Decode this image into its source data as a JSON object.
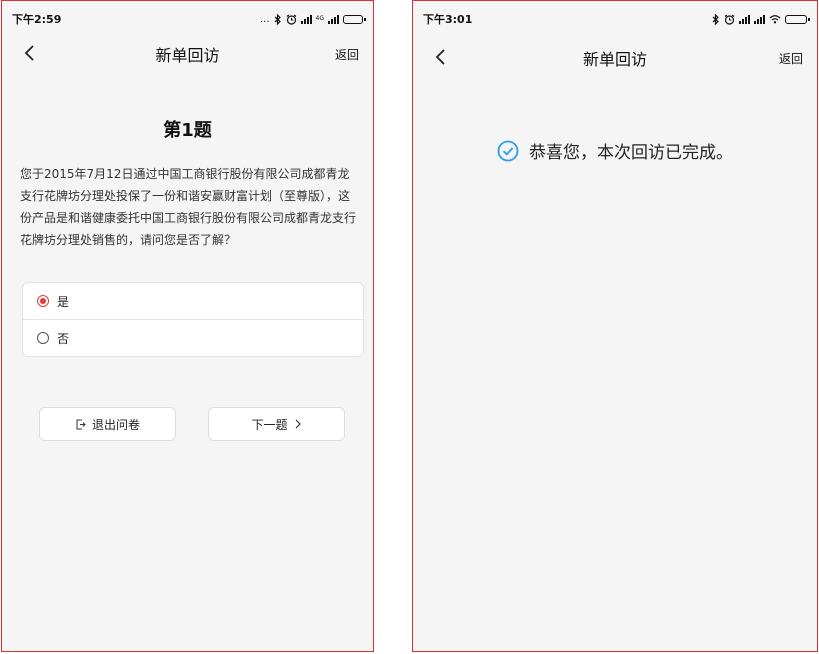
{
  "left": {
    "status": {
      "time": "下午2:59",
      "more": "...",
      "network": "4G"
    },
    "nav": {
      "title": "新单回访",
      "return_label": "返回"
    },
    "question": {
      "title": "第1题",
      "text": "您于2015年7月12日通过中国工商银行股份有限公司成都青龙支行花牌坊分理处投保了一份和谐安赢财富计划（至尊版），这份产品是和谐健康委托中国工商银行股份有限公司成都青龙支行花牌坊分理处销售的，请问您是否了解？",
      "options": [
        {
          "label": "是",
          "selected": true
        },
        {
          "label": "否",
          "selected": false
        }
      ]
    },
    "buttons": {
      "exit_label": "退出问卷",
      "next_label": "下一题"
    }
  },
  "right": {
    "status": {
      "time": "下午3:01"
    },
    "nav": {
      "title": "新单回访",
      "return_label": "返回"
    },
    "message": "恭喜您，本次回访已完成。"
  },
  "colors": {
    "accent_red": "#e23c3c",
    "check_blue": "#2b9ee8",
    "frame_red": "#d93030"
  },
  "icons": [
    "bluetooth-icon",
    "alarm-icon",
    "signal-icon",
    "wifi-icon",
    "battery-icon",
    "back-arrow-icon",
    "exit-icon",
    "chevron-right-icon",
    "check-circle-icon"
  ]
}
